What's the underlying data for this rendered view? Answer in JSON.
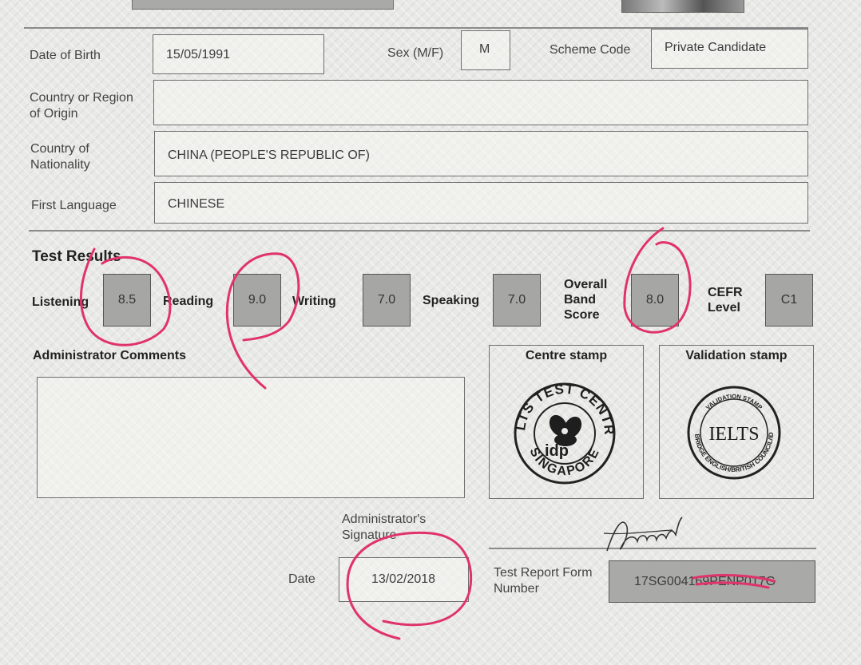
{
  "candidate": {
    "dob_label": "Date of Birth",
    "dob": "15/05/1991",
    "sex_label": "Sex (M/F)",
    "sex": "M",
    "scheme_label": "Scheme Code",
    "scheme": "Private Candidate",
    "origin_label_1": "Country or Region",
    "origin_label_2": "of Origin",
    "origin": "",
    "nationality_label_1": "Country of",
    "nationality_label_2": "Nationality",
    "nationality": "CHINA (PEOPLE'S REPUBLIC OF)",
    "language_label": "First Language",
    "language": "CHINESE"
  },
  "results": {
    "title": "Test Results",
    "listening_label": "Listening",
    "listening": "8.5",
    "reading_label": "Reading",
    "reading": "9.0",
    "writing_label": "Writing",
    "writing": "7.0",
    "speaking_label": "Speaking",
    "speaking": "7.0",
    "overall_label_1": "Overall",
    "overall_label_2": "Band",
    "overall_label_3": "Score",
    "overall": "8.0",
    "cefr_label_1": "CEFR",
    "cefr_label_2": "Level",
    "cefr": "C1"
  },
  "admin": {
    "comments_label": "Administrator Comments",
    "comments": "",
    "centre_stamp_label": "Centre stamp",
    "validation_stamp_label": "Validation stamp",
    "centre_stamp_text_top": "IELTS TEST CENTRE",
    "centre_stamp_text_bottom": "SINGAPORE",
    "centre_stamp_logo": "idp",
    "validation_stamp_top": "VALIDATION STAMP",
    "validation_stamp_bottom": "CAMBRIDGE ENGLISH/BRITISH COUNCIL/IDP:IA",
    "validation_stamp_center": "IELTS",
    "signature_label_1": "Administrator's",
    "signature_label_2": "Signature",
    "date_label": "Date",
    "date": "13/02/2018",
    "trf_label_1": "Test Report Form",
    "trf_label_2": "Number",
    "trf_number": "17SG004169PENP017G"
  },
  "colors": {
    "annotation": "#e0336a",
    "score_box": "#a6a6a4"
  }
}
